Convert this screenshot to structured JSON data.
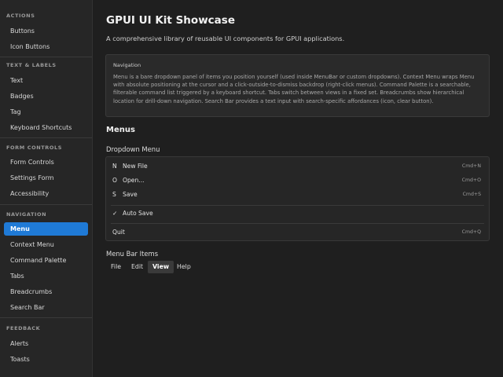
{
  "sidebar": {
    "sections": [
      {
        "title": "ACTIONS",
        "items": [
          {
            "label": "Buttons"
          },
          {
            "label": "Icon Buttons"
          }
        ]
      },
      {
        "title": "TEXT & LABELS",
        "items": [
          {
            "label": "Text"
          },
          {
            "label": "Badges"
          },
          {
            "label": "Tag"
          },
          {
            "label": "Keyboard Shortcuts"
          }
        ]
      },
      {
        "title": "FORM CONTROLS",
        "items": [
          {
            "label": "Form Controls"
          },
          {
            "label": "Settings Form"
          },
          {
            "label": "Accessibility"
          }
        ]
      },
      {
        "title": "NAVIGATION",
        "items": [
          {
            "label": "Menu",
            "active": true
          },
          {
            "label": "Context Menu"
          },
          {
            "label": "Command Palette"
          },
          {
            "label": "Tabs"
          },
          {
            "label": "Breadcrumbs"
          },
          {
            "label": "Search Bar"
          }
        ]
      },
      {
        "title": "FEEDBACK",
        "items": [
          {
            "label": "Alerts"
          },
          {
            "label": "Toasts"
          }
        ]
      }
    ]
  },
  "main": {
    "title": "GPUI UI Kit Showcase",
    "subtitle": "A comprehensive library of reusable UI components for GPUI applications.",
    "info": {
      "title": "Navigation",
      "text": "Menu is a bare dropdown panel of items you position yourself (used inside MenuBar or custom dropdowns). Context Menu wraps Menu with absolute positioning at the cursor and a click-outside-to-dismiss backdrop (right-click menus). Command Palette is a searchable, filterable command list triggered by a keyboard shortcut. Tabs switch between views in a fixed set. Breadcrumbs show hierarchical location for drill-down navigation. Search Bar provides a text input with search-specific affordances (icon, clear button)."
    },
    "section_title": "Menus",
    "dropdown": {
      "title": "Dropdown Menu",
      "items": [
        {
          "key": "N",
          "label": "New File",
          "shortcut": "Cmd+N"
        },
        {
          "key": "O",
          "label": "Open...",
          "shortcut": "Cmd+O"
        },
        {
          "key": "S",
          "label": "Save",
          "shortcut": "Cmd+S"
        },
        {
          "key": "✓",
          "label": "Auto Save",
          "shortcut": ""
        },
        {
          "key": "",
          "label": "Quit",
          "shortcut": "Cmd+Q"
        }
      ]
    },
    "menubar": {
      "title": "Menu Bar Items",
      "items": [
        {
          "label": "File"
        },
        {
          "label": "Edit"
        },
        {
          "label": "View",
          "active": true
        },
        {
          "label": "Help"
        }
      ]
    }
  },
  "colors": {
    "accent": "#1f7ad6",
    "background": "#1f1f1f",
    "sidebar": "#262626"
  }
}
